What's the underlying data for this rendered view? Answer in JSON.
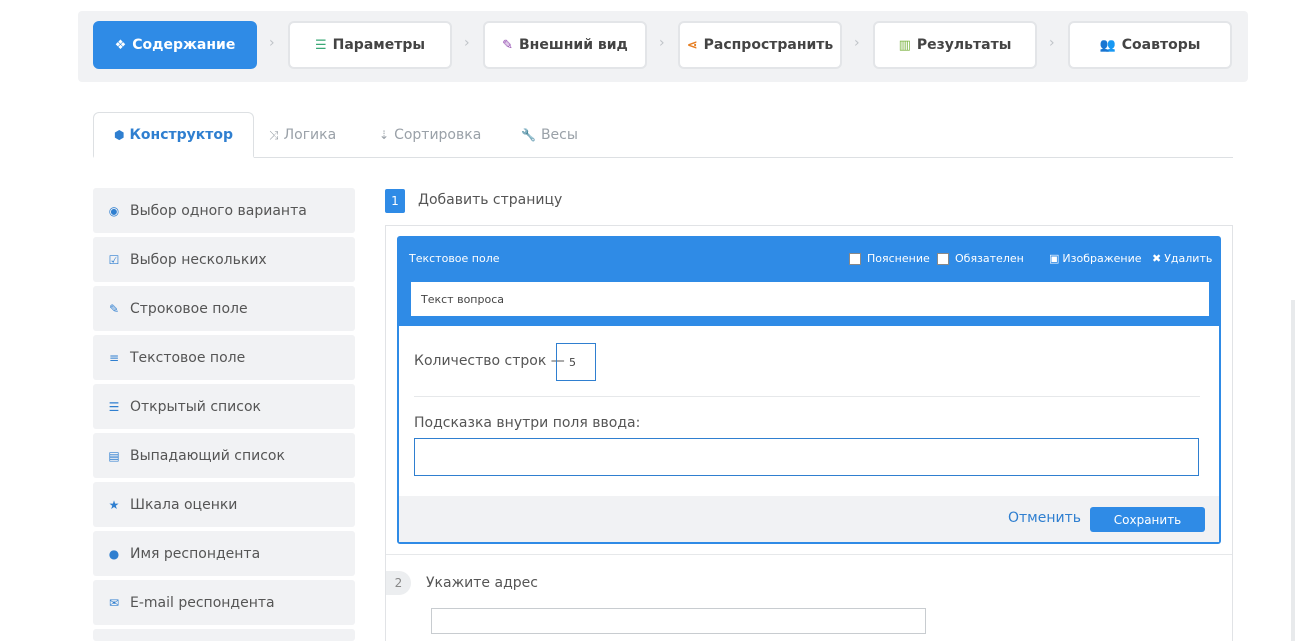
{
  "wizard": {
    "steps": [
      {
        "label": "Содержание",
        "icon": "cubes-icon"
      },
      {
        "label": "Параметры",
        "icon": "sliders-icon"
      },
      {
        "label": "Внешний вид",
        "icon": "brush-icon"
      },
      {
        "label": "Распространить",
        "icon": "share-icon"
      },
      {
        "label": "Результаты",
        "icon": "bar-chart-icon"
      },
      {
        "label": "Соавторы",
        "icon": "users-icon"
      }
    ],
    "active_step": "Содержание"
  },
  "tabs": [
    {
      "label": "Конструктор",
      "icon": "cube-icon"
    },
    {
      "label": "Логика",
      "icon": "random-icon"
    },
    {
      "label": "Сортировка",
      "icon": "sort-icon"
    },
    {
      "label": "Весы",
      "icon": "wrench-icon"
    }
  ],
  "sidebar": {
    "items": [
      {
        "label": "Выбор одного варианта",
        "icon": "radio-check-icon"
      },
      {
        "label": "Выбор нескольких",
        "icon": "checkbox-icon"
      },
      {
        "label": "Строковое поле",
        "icon": "edit-icon"
      },
      {
        "label": "Текстовое поле",
        "icon": "align-left-icon"
      },
      {
        "label": "Открытый список",
        "icon": "list-icon"
      },
      {
        "label": "Выпадающий список",
        "icon": "dropdown-list-icon"
      },
      {
        "label": "Шкала оценки",
        "icon": "star-icon"
      },
      {
        "label": "Имя респондента",
        "icon": "user-icon"
      },
      {
        "label": "E-mail респондента",
        "icon": "envelope-icon"
      }
    ]
  },
  "page": {
    "number": "1",
    "title": "Добавить страницу"
  },
  "question_editor": {
    "type_label": "Текстовое поле",
    "explain_label": "Пояснение",
    "required_label": "Обязателен",
    "image_label": "Изображение",
    "delete_label": "Удалить",
    "question_text": "Текст вопроса",
    "rows_label": "Количество строк —",
    "rows_value": "5",
    "hint_label": "Подсказка внутри поля ввода:",
    "hint_value": "",
    "cancel_label": "Отменить",
    "save_label": "Сохранить"
  },
  "question2": {
    "number": "2",
    "title": "Укажите адрес"
  },
  "colors": {
    "accent": "#2f8be6",
    "link": "#2f7fd0",
    "panel_bg": "#f1f2f4"
  }
}
